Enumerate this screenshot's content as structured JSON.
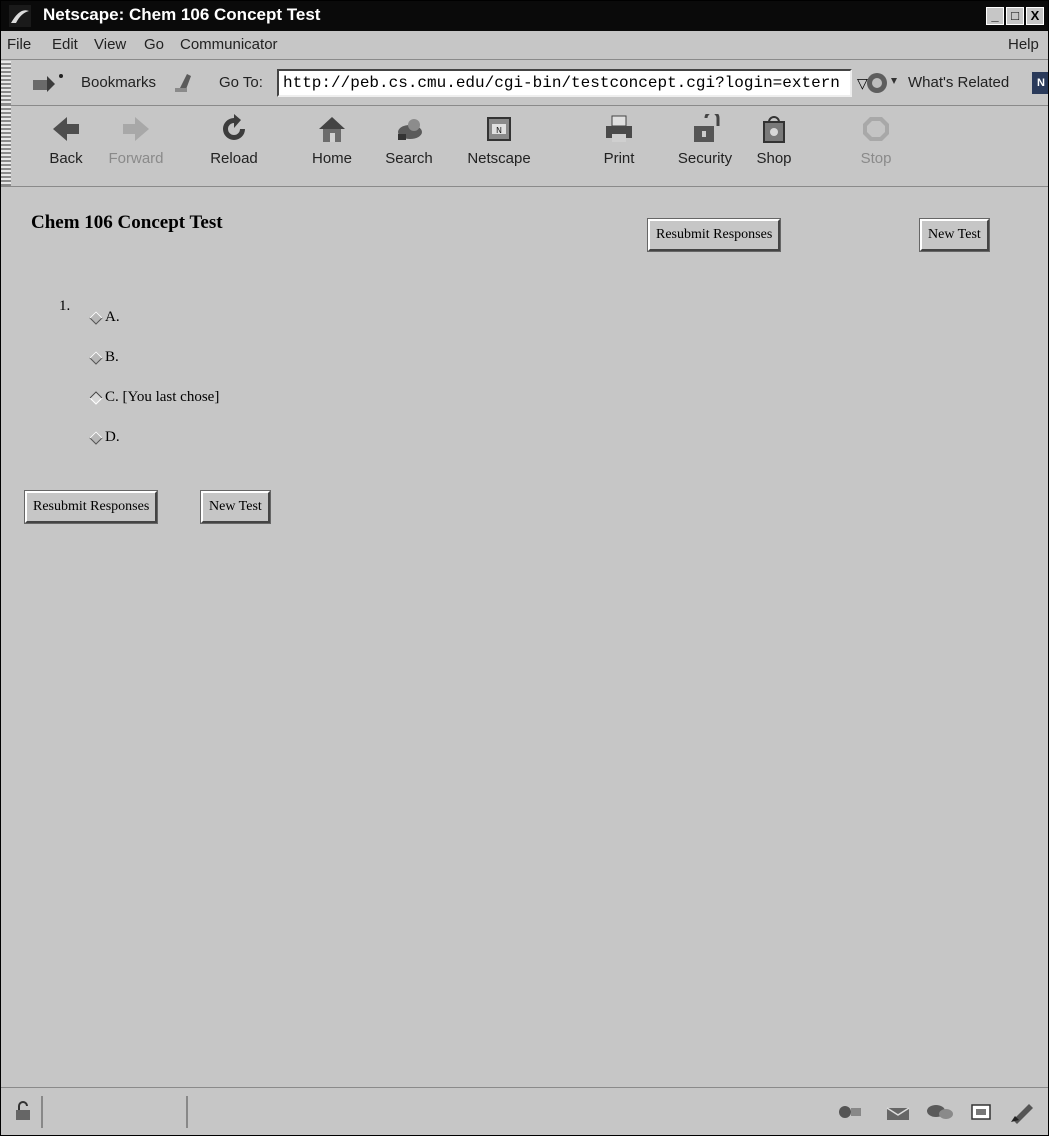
{
  "window": {
    "title": "Netscape: Chem 106 Concept Test"
  },
  "window_controls": {
    "minimize": "_",
    "maximize": "□",
    "close": "X"
  },
  "menu": [
    "File",
    "Edit",
    "View",
    "Go",
    "Communicator"
  ],
  "menu_help": "Help",
  "location": {
    "bookmarks_label": "Bookmarks",
    "goto_label": "Go To:",
    "url": "http://peb.cs.cmu.edu/cgi-bin/testconcept.cgi?login=extern",
    "related_label": "What's Related"
  },
  "toolbar": {
    "back": "Back",
    "forward": "Forward",
    "reload": "Reload",
    "home": "Home",
    "search": "Search",
    "netscape": "Netscape",
    "print": "Print",
    "security": "Security",
    "shop": "Shop",
    "stop": "Stop"
  },
  "page": {
    "title": "Chem 106 Concept Test",
    "resubmit_label": "Resubmit Responses",
    "newtest_label": "New Test",
    "question_number": "1.",
    "options": [
      {
        "label": "A.",
        "selected": false
      },
      {
        "label": "B.",
        "selected": false
      },
      {
        "label": "C. [You last chose]",
        "selected": true
      },
      {
        "label": "D.",
        "selected": false
      }
    ]
  },
  "icons": {
    "lock": "padlock-icon",
    "tray": [
      "component-icon",
      "mail-icon",
      "discussion-icon",
      "composer-icon",
      "edit-icon"
    ]
  }
}
